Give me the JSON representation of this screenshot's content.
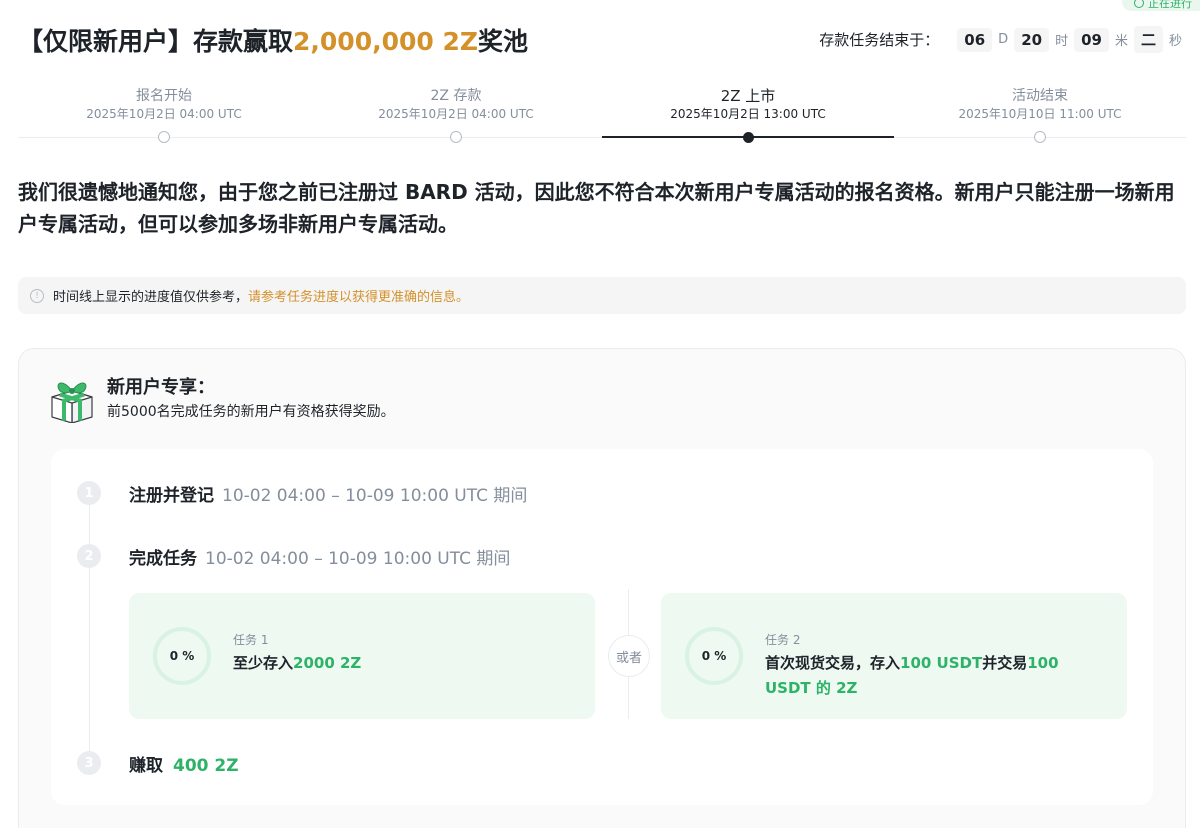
{
  "status_badge": "正在进行",
  "header": {
    "title_prefix": "【仅限新用户】存款赢取",
    "title_amount": "2,000,000 2Z",
    "title_suffix": "奖池"
  },
  "countdown": {
    "label": "存款任务结束于：",
    "days": "06",
    "days_unit": "D",
    "hours": "20",
    "hours_unit": "时",
    "minutes": "09",
    "minutes_unit": "米",
    "seconds": "二",
    "seconds_unit": "秒"
  },
  "timeline": [
    {
      "name": "报名开始",
      "date": "2025年10月2日 04:00 UTC",
      "active": false
    },
    {
      "name": "2Z 存款",
      "date": "2025年10月2日 04:00 UTC",
      "active": false
    },
    {
      "name": "2Z 上市",
      "date": "2025年10月2日 13:00 UTC",
      "active": true
    },
    {
      "name": "活动结束",
      "date": "2025年10月10日 11:00 UTC",
      "active": false
    }
  ],
  "notice": "我们很遗憾地通知您，由于您之前已注册过 BARD 活动，因此您不符合本次新用户专属活动的报名资格。新用户只能注册一场新用户专属活动，但可以参加多场非新用户专属活动。",
  "info": {
    "text": "时间线上显示的进度值仅供参考，",
    "link": "请参考任务进度以获得更准确的信息。"
  },
  "card": {
    "title": "新用户专享：",
    "subtitle": "前5000名完成任务的新用户有资格获得奖励。",
    "steps": [
      {
        "num": "1",
        "title": "注册并登记",
        "period": "10-02 04:00 – 10-09 10:00 UTC 期间"
      },
      {
        "num": "2",
        "title": "完成任务",
        "period": "10-02 04:00 – 10-09 10:00 UTC 期间"
      },
      {
        "num": "3",
        "title": "赚取",
        "reward": "400 2Z"
      }
    ],
    "or_label": "或者",
    "tasks": [
      {
        "label": "任务 1",
        "progress": "0 %",
        "progress_value": 0,
        "text_a": "至少存入",
        "text_b": "2000 2Z",
        "text_c": "",
        "text_d": "",
        "text_e": ""
      },
      {
        "label": "任务 2",
        "progress": "0 %",
        "progress_value": 0,
        "text_a": "首次现货交易，存入",
        "text_b": "100 USDT",
        "text_c": "并交易",
        "text_d": "100 USDT 的 2Z",
        "text_e": ""
      }
    ]
  },
  "colors": {
    "accent_gold": "#d4912a",
    "accent_green": "#2eb267",
    "text": "#1e2329",
    "muted": "#848e9c"
  }
}
